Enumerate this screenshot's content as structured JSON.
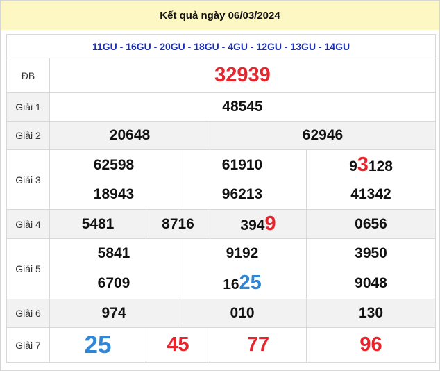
{
  "title": "Kết quả ngày 06/03/2024",
  "codes": "11GU - 16GU - 20GU - 18GU - 4GU - 12GU - 13GU - 14GU",
  "prizes": {
    "db": {
      "label": "ĐB",
      "value": "32939"
    },
    "g1": {
      "label": "Giải 1",
      "value": "48545"
    },
    "g2": {
      "label": "Giải 2",
      "values": [
        "20648",
        "62946"
      ]
    },
    "g3": {
      "label": "Giải 3",
      "values": [
        [
          "62598",
          "61910",
          "9",
          "3",
          "128"
        ],
        [
          "18943",
          "96213",
          "41342"
        ]
      ]
    },
    "g4": {
      "label": "Giải 4",
      "values": [
        "5481",
        "8716",
        "394",
        "9",
        "0656"
      ]
    },
    "g5": {
      "label": "Giải 5",
      "values": [
        [
          "5841",
          "9192",
          "3950"
        ],
        [
          "6709",
          "16",
          "25",
          "9048"
        ]
      ]
    },
    "g6": {
      "label": "Giải 6",
      "values": [
        "974",
        "010",
        "130"
      ]
    },
    "g7": {
      "label": "Giải 7",
      "values": [
        "25",
        "45",
        "77",
        "96"
      ]
    }
  },
  "colors": {
    "highlight_red": "#e8242c",
    "highlight_blue": "#2f86d6",
    "title_bg": "#fdf7c3",
    "codes_color": "#1a2fb5"
  }
}
